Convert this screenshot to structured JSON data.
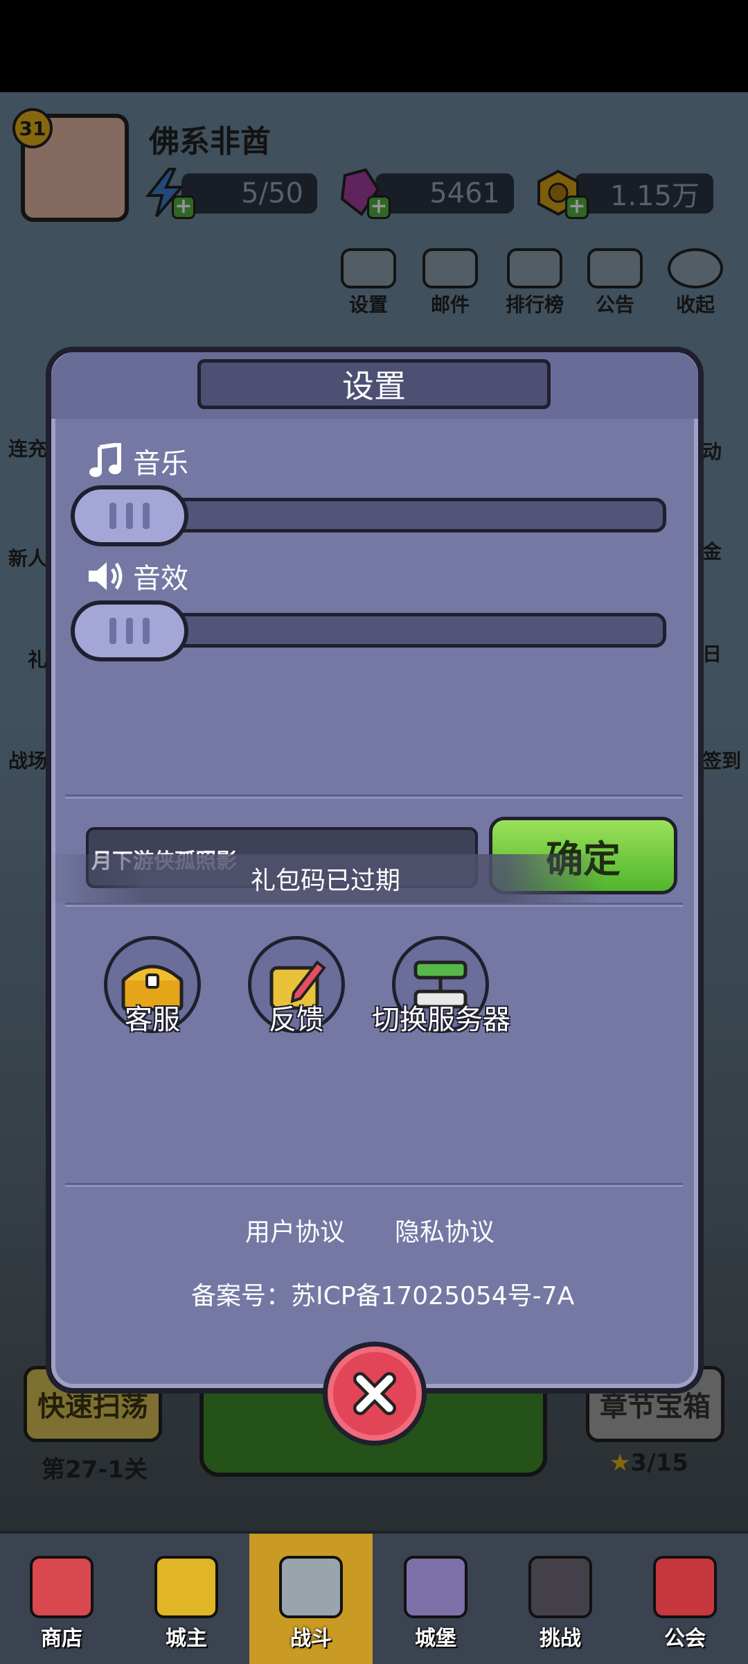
{
  "player": {
    "level": "31",
    "name": "佛系非酋",
    "energy": "5/50",
    "gems": "5461",
    "gold": "1.15万"
  },
  "top_buttons": [
    {
      "label": "设置",
      "icon": "gear-icon"
    },
    {
      "label": "邮件",
      "icon": "mail-icon"
    },
    {
      "label": "排行榜",
      "icon": "leaderboard-icon"
    },
    {
      "label": "公告",
      "icon": "megaphone-icon"
    },
    {
      "label": "收起",
      "icon": "collapse-icon"
    }
  ],
  "side_left": [
    "连充",
    "新人",
    "礼",
    "战场"
  ],
  "side_right": [
    "动",
    "金",
    "日",
    "签到"
  ],
  "lower": {
    "quick_sweep": "快速扫荡",
    "stage": "第27-1关",
    "chapter_chest": "章节宝箱",
    "stars": "3/15"
  },
  "nav": [
    {
      "label": "商店",
      "icon": "shop-icon"
    },
    {
      "label": "城主",
      "icon": "crown-icon"
    },
    {
      "label": "战斗",
      "icon": "crossed-swords-icon"
    },
    {
      "label": "城堡",
      "icon": "castle-icon"
    },
    {
      "label": "挑战",
      "icon": "demon-icon"
    },
    {
      "label": "公会",
      "icon": "guild-banner-icon"
    }
  ],
  "settings": {
    "title": "设置",
    "music_label": "音乐",
    "music_level": 0,
    "sfx_label": "音效",
    "sfx_level": 0,
    "gift_code_value": "月下游侠孤照影",
    "confirm_label": "确定",
    "toast": "礼包码已过期",
    "actions": [
      {
        "label": "客服",
        "icon": "treasure-chest-icon"
      },
      {
        "label": "反馈",
        "icon": "pencil-note-icon"
      },
      {
        "label": "切换服务器",
        "icon": "server-switch-icon"
      }
    ],
    "user_agreement": "用户协议",
    "privacy_agreement": "隐私协议",
    "record_number": "备案号：苏ICP备17025054号-7A"
  },
  "colors": {
    "dialog_bg": "#7578a3",
    "confirm_green": "#51b52b",
    "close_red": "#e24558",
    "nav_active": "#c99b24"
  }
}
